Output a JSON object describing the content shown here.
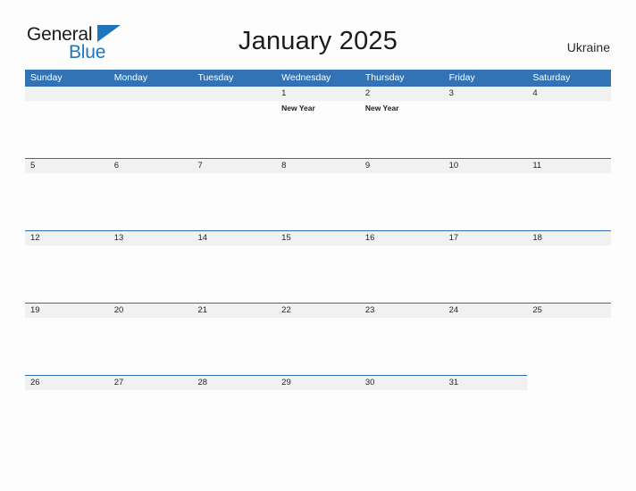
{
  "brand": {
    "name_part1": "General",
    "name_part2": "Blue",
    "triangle_color": "#1f76bc"
  },
  "header": {
    "title": "January 2025",
    "region": "Ukraine"
  },
  "calendar": {
    "accent_color": "#3173b5",
    "band_color": "#f1f1f1",
    "weekdays": [
      "Sunday",
      "Monday",
      "Tuesday",
      "Wednesday",
      "Thursday",
      "Friday",
      "Saturday"
    ],
    "weeks": [
      [
        {
          "date": "",
          "filled": true,
          "events": []
        },
        {
          "date": "",
          "filled": true,
          "events": []
        },
        {
          "date": "",
          "filled": true,
          "events": []
        },
        {
          "date": "1",
          "filled": true,
          "events": [
            "New Year"
          ]
        },
        {
          "date": "2",
          "filled": true,
          "events": [
            "New Year"
          ]
        },
        {
          "date": "3",
          "filled": true,
          "events": []
        },
        {
          "date": "4",
          "filled": true,
          "events": []
        }
      ],
      [
        {
          "date": "5",
          "filled": true,
          "events": []
        },
        {
          "date": "6",
          "filled": true,
          "events": []
        },
        {
          "date": "7",
          "filled": true,
          "events": []
        },
        {
          "date": "8",
          "filled": true,
          "events": []
        },
        {
          "date": "9",
          "filled": true,
          "events": []
        },
        {
          "date": "10",
          "filled": true,
          "events": []
        },
        {
          "date": "11",
          "filled": true,
          "events": []
        }
      ],
      [
        {
          "date": "12",
          "filled": true,
          "events": []
        },
        {
          "date": "13",
          "filled": true,
          "events": []
        },
        {
          "date": "14",
          "filled": true,
          "events": []
        },
        {
          "date": "15",
          "filled": true,
          "events": []
        },
        {
          "date": "16",
          "filled": true,
          "events": []
        },
        {
          "date": "17",
          "filled": true,
          "events": []
        },
        {
          "date": "18",
          "filled": true,
          "events": []
        }
      ],
      [
        {
          "date": "19",
          "filled": true,
          "events": []
        },
        {
          "date": "20",
          "filled": true,
          "events": []
        },
        {
          "date": "21",
          "filled": true,
          "events": []
        },
        {
          "date": "22",
          "filled": true,
          "events": []
        },
        {
          "date": "23",
          "filled": true,
          "events": []
        },
        {
          "date": "24",
          "filled": true,
          "events": []
        },
        {
          "date": "25",
          "filled": true,
          "events": []
        }
      ],
      [
        {
          "date": "26",
          "filled": true,
          "events": []
        },
        {
          "date": "27",
          "filled": true,
          "events": []
        },
        {
          "date": "28",
          "filled": true,
          "events": []
        },
        {
          "date": "29",
          "filled": true,
          "events": []
        },
        {
          "date": "30",
          "filled": true,
          "events": []
        },
        {
          "date": "31",
          "filled": true,
          "events": []
        },
        {
          "date": "",
          "filled": false,
          "events": []
        }
      ]
    ]
  }
}
